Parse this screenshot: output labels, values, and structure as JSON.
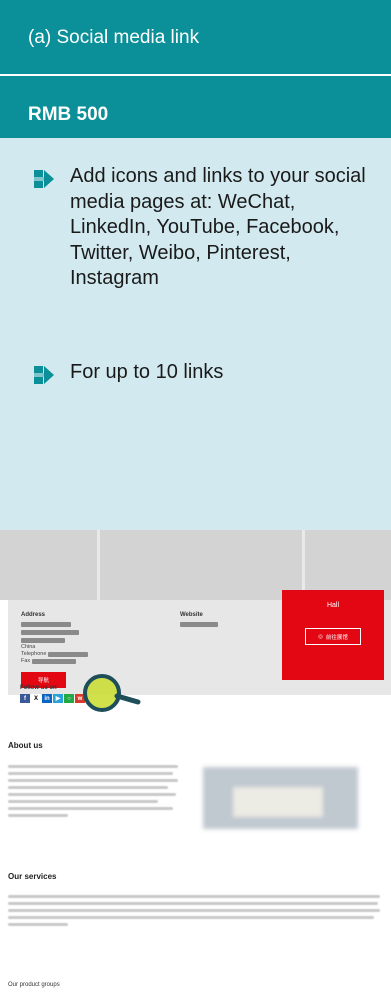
{
  "header": {
    "title": "(a) Social media link"
  },
  "price": {
    "label": "RMB 500"
  },
  "features": [
    {
      "text": "Add icons and links to your social media pages at: WeChat, LinkedIn, YouTube, Facebook, Twitter, Weibo, Pinterest, Instagram",
      "icon": "arrow-right-icon"
    },
    {
      "text": "For up to 10 links",
      "icon": "arrow-right-icon"
    }
  ],
  "mockup": {
    "address_label": "Address",
    "website_label": "Website",
    "country": "China",
    "telephone_label": "Telephone",
    "fax_label": "Fax",
    "navigate_button": "导航",
    "hall_title": "Hall",
    "hall_button": "前往展馆",
    "follow_label": "Follow us on",
    "about_title": "About us",
    "services_title": "Our services",
    "product_groups_title": "Our product groups"
  },
  "colors": {
    "teal": "#0b8f98",
    "light_teal": "#d2eaef",
    "red": "#e30613",
    "magnifier_lens": "#c8dc2d",
    "magnifier_handle": "#1d4e5a"
  },
  "social_icons": [
    "facebook-icon",
    "x-icon",
    "linkedin-icon",
    "youtube-icon",
    "wechat-icon",
    "weibo-icon"
  ]
}
